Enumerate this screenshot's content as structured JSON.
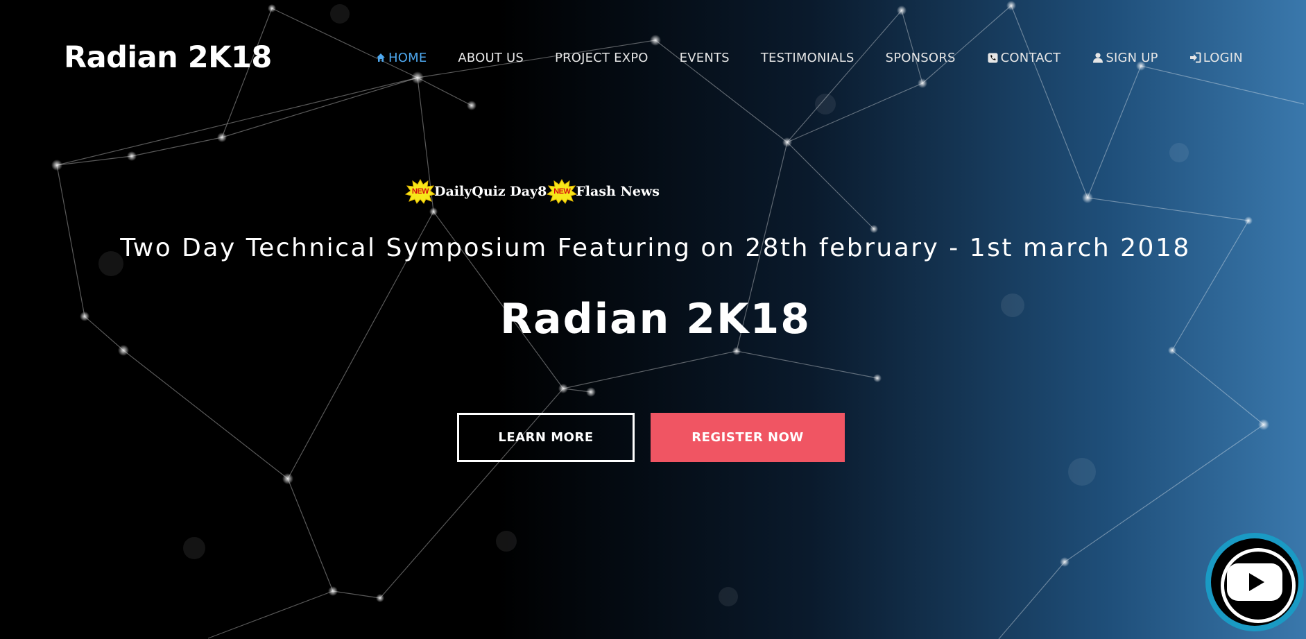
{
  "brand": {
    "title": "Radian 2K18"
  },
  "nav": {
    "items": [
      {
        "label": "HOME",
        "icon": "home-icon",
        "active": true
      },
      {
        "label": "ABOUT US"
      },
      {
        "label": "PROJECT EXPO"
      },
      {
        "label": "EVENTS"
      },
      {
        "label": "TESTIMONIALS"
      },
      {
        "label": "SPONSORS"
      },
      {
        "label": "CONTACT",
        "icon": "phone-icon"
      },
      {
        "label": "SIGN UP",
        "icon": "user-icon"
      },
      {
        "label": "LOGIN",
        "icon": "login-icon"
      }
    ]
  },
  "ticker": {
    "items": [
      {
        "badge": "NEW",
        "label": "DailyQuiz Day8"
      },
      {
        "badge": "NEW",
        "label": "Flash News"
      }
    ]
  },
  "hero": {
    "tagline": "Two Day Technical Symposium Featuring on 28th february - 1st march 2018",
    "title": "Radian 2K18",
    "learn_more": "LEARN MORE",
    "register": "REGISTER NOW"
  },
  "colors": {
    "accent_nav": "#4ea8ef",
    "register_button": "#f05563",
    "youtube_ring": "#1a9ac4"
  }
}
